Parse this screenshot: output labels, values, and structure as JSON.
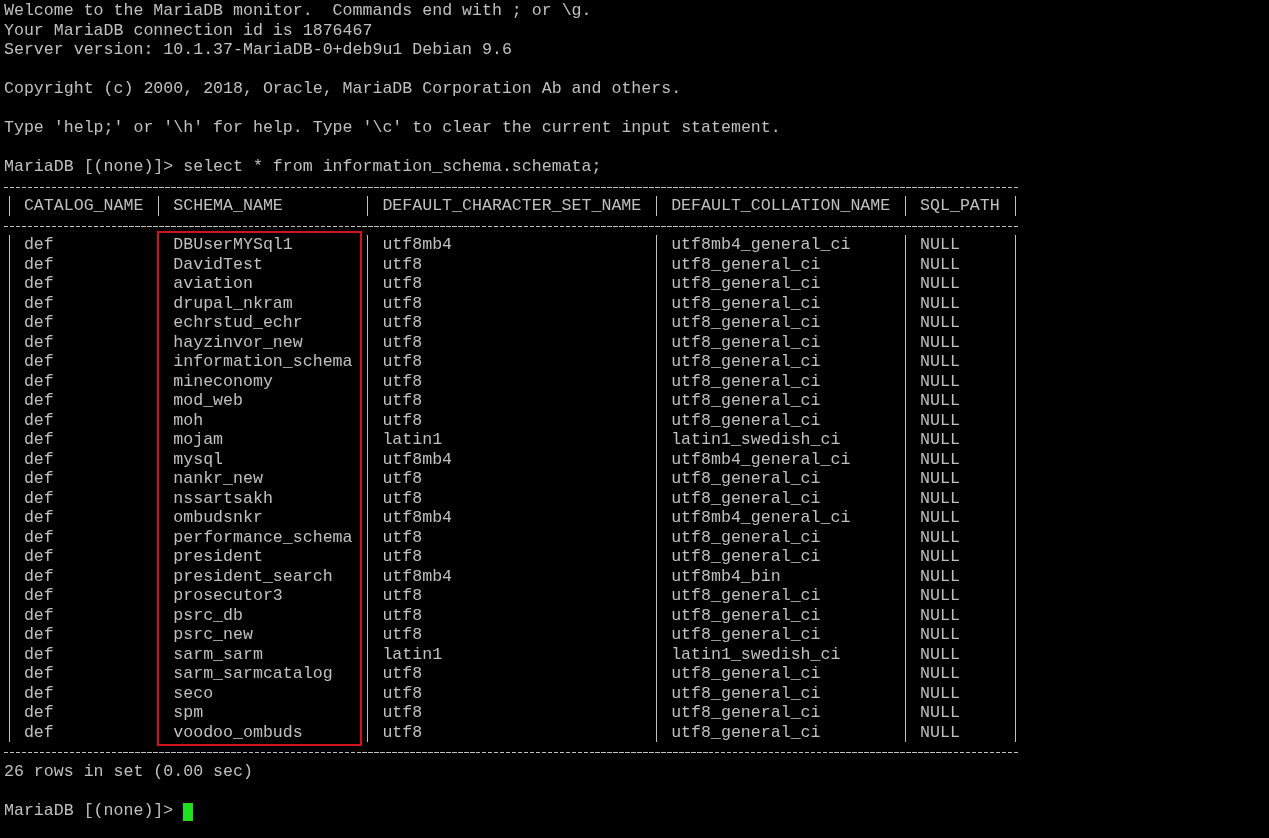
{
  "banner": [
    [
      "Welcome to the MariaDB monitor.  Commands end with ; or \\g.",
      "Your MariaDB connection id is 1876467",
      "Server version: 10.1.37-MariaDB-0+deb9u1 Debian 9.6"
    ],
    [
      "Copyright (c) 2000, 2018, Oracle, MariaDB Corporation Ab and others."
    ],
    [
      "Type 'help;' or '\\h' for help. Type '\\c' to clear the current input statement."
    ]
  ],
  "query": {
    "prompt": "MariaDB [(none)]>",
    "command": "select * from information_schema.schemata;"
  },
  "table": {
    "columns": [
      {
        "name": "CATALOG_NAME",
        "highlighted": false
      },
      {
        "name": "SCHEMA_NAME",
        "highlighted": true
      },
      {
        "name": "DEFAULT_CHARACTER_SET_NAME",
        "highlighted": false
      },
      {
        "name": "DEFAULT_COLLATION_NAME",
        "highlighted": false
      },
      {
        "name": "SQL_PATH",
        "highlighted": false
      }
    ],
    "rows": [
      [
        "def",
        "DBUserMYSql1",
        "utf8mb4",
        "utf8mb4_general_ci",
        "NULL"
      ],
      [
        "def",
        "DavidTest",
        "utf8",
        "utf8_general_ci",
        "NULL"
      ],
      [
        "def",
        "aviation",
        "utf8",
        "utf8_general_ci",
        "NULL"
      ],
      [
        "def",
        "drupal_nkram",
        "utf8",
        "utf8_general_ci",
        "NULL"
      ],
      [
        "def",
        "echrstud_echr",
        "utf8",
        "utf8_general_ci",
        "NULL"
      ],
      [
        "def",
        "hayzinvor_new",
        "utf8",
        "utf8_general_ci",
        "NULL"
      ],
      [
        "def",
        "information_schema",
        "utf8",
        "utf8_general_ci",
        "NULL"
      ],
      [
        "def",
        "mineconomy",
        "utf8",
        "utf8_general_ci",
        "NULL"
      ],
      [
        "def",
        "mod_web",
        "utf8",
        "utf8_general_ci",
        "NULL"
      ],
      [
        "def",
        "moh",
        "utf8",
        "utf8_general_ci",
        "NULL"
      ],
      [
        "def",
        "mojam",
        "latin1",
        "latin1_swedish_ci",
        "NULL"
      ],
      [
        "def",
        "mysql",
        "utf8mb4",
        "utf8mb4_general_ci",
        "NULL"
      ],
      [
        "def",
        "nankr_new",
        "utf8",
        "utf8_general_ci",
        "NULL"
      ],
      [
        "def",
        "nssartsakh",
        "utf8",
        "utf8_general_ci",
        "NULL"
      ],
      [
        "def",
        "ombudsnkr",
        "utf8mb4",
        "utf8mb4_general_ci",
        "NULL"
      ],
      [
        "def",
        "performance_schema",
        "utf8",
        "utf8_general_ci",
        "NULL"
      ],
      [
        "def",
        "president",
        "utf8",
        "utf8_general_ci",
        "NULL"
      ],
      [
        "def",
        "president_search",
        "utf8mb4",
        "utf8mb4_bin",
        "NULL"
      ],
      [
        "def",
        "prosecutor3",
        "utf8",
        "utf8_general_ci",
        "NULL"
      ],
      [
        "def",
        "psrc_db",
        "utf8",
        "utf8_general_ci",
        "NULL"
      ],
      [
        "def",
        "psrc_new",
        "utf8",
        "utf8_general_ci",
        "NULL"
      ],
      [
        "def",
        "sarm_sarm",
        "latin1",
        "latin1_swedish_ci",
        "NULL"
      ],
      [
        "def",
        "sarm_sarmcatalog",
        "utf8",
        "utf8_general_ci",
        "NULL"
      ],
      [
        "def",
        "seco",
        "utf8",
        "utf8_general_ci",
        "NULL"
      ],
      [
        "def",
        "spm",
        "utf8",
        "utf8_general_ci",
        "NULL"
      ],
      [
        "def",
        "voodoo_ombuds",
        "utf8",
        "utf8_general_ci",
        "NULL"
      ]
    ]
  },
  "summary": "26 rows in set (0.00 sec)",
  "prompt": {
    "text": "MariaDB [(none)]>",
    "cursor": true
  }
}
